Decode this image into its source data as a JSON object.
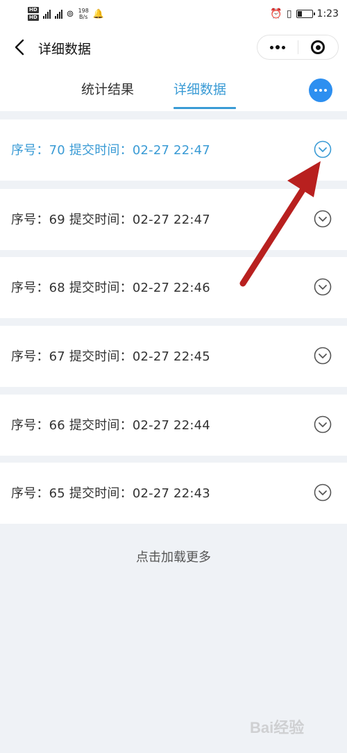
{
  "status_bar": {
    "net_rate": "198",
    "net_unit": "B/s",
    "time": "1:23"
  },
  "nav": {
    "title": "详细数据",
    "back_icon": "chevron-left-icon"
  },
  "tabs": [
    {
      "label": "统计结果",
      "active": false
    },
    {
      "label": "详细数据",
      "active": true
    }
  ],
  "list": {
    "items": [
      {
        "text": "序号：70  提交时间：02-27 22:47",
        "active": true
      },
      {
        "text": "序号：69  提交时间：02-27 22:47",
        "active": false
      },
      {
        "text": "序号：68  提交时间：02-27 22:46",
        "active": false
      },
      {
        "text": "序号：67  提交时间：02-27 22:45",
        "active": false
      },
      {
        "text": "序号：66  提交时间：02-27 22:44",
        "active": false
      },
      {
        "text": "序号：65  提交时间：02-27 22:43",
        "active": false
      }
    ]
  },
  "load_more": "点击加载更多",
  "watermark": "Bai经验",
  "colors": {
    "accent": "#3a9bd5",
    "more_button": "#2d8ff0",
    "annotation_arrow": "#b8201f"
  }
}
